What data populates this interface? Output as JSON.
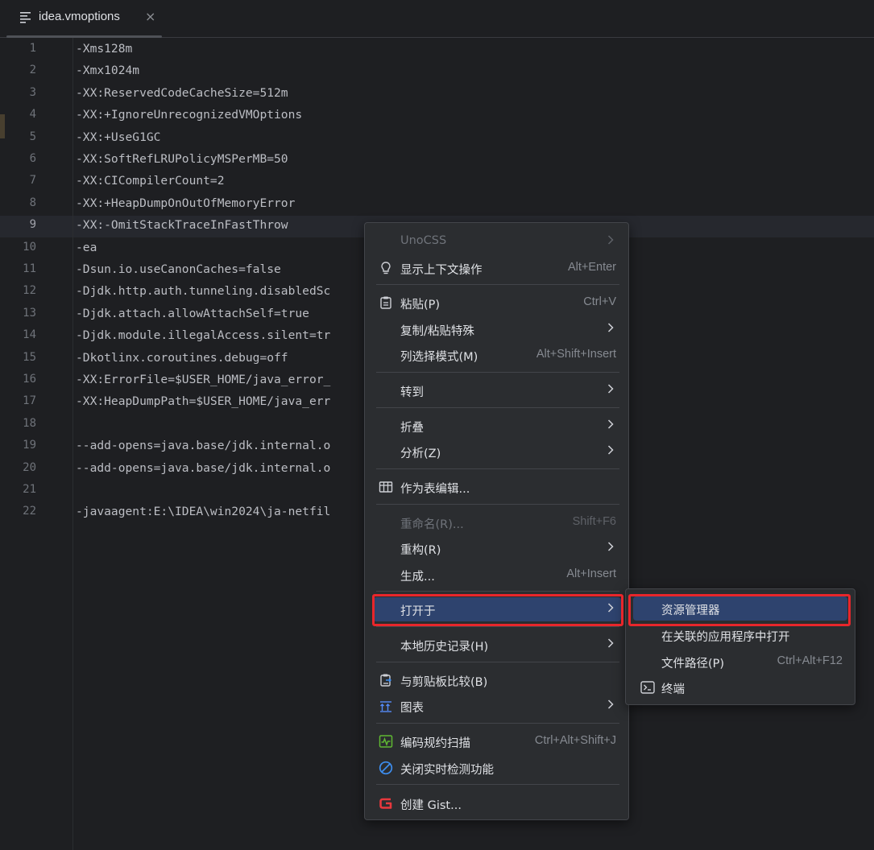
{
  "tab": {
    "name": "idea.vmoptions",
    "close": "×",
    "icon": "text-file-icon"
  },
  "editor": {
    "current_line": 9,
    "lines": [
      {
        "n": "1",
        "text": "-Xms128m"
      },
      {
        "n": "2",
        "text": "-Xmx1024m"
      },
      {
        "n": "3",
        "text": "-XX:ReservedCodeCacheSize=512m"
      },
      {
        "n": "4",
        "text": "-XX:+IgnoreUnrecognizedVMOptions"
      },
      {
        "n": "5",
        "text": "-XX:+UseG1GC"
      },
      {
        "n": "6",
        "text": "-XX:SoftRefLRUPolicyMSPerMB=50"
      },
      {
        "n": "7",
        "text": "-XX:CICompilerCount=2"
      },
      {
        "n": "8",
        "text": "-XX:+HeapDumpOnOutOfMemoryError"
      },
      {
        "n": "9",
        "text": "-XX:-OmitStackTraceInFastThrow"
      },
      {
        "n": "10",
        "text": "-ea"
      },
      {
        "n": "11",
        "text": "-Dsun.io.useCanonCaches=false"
      },
      {
        "n": "12",
        "text": "-Djdk.http.auth.tunneling.disabledSc"
      },
      {
        "n": "13",
        "text": "-Djdk.attach.allowAttachSelf=true"
      },
      {
        "n": "14",
        "text": "-Djdk.module.illegalAccess.silent=tr"
      },
      {
        "n": "15",
        "text": "-Dkotlinx.coroutines.debug=off"
      },
      {
        "n": "16",
        "text": "-XX:ErrorFile=$USER_HOME/java_error_"
      },
      {
        "n": "17",
        "text": "-XX:HeapDumpPath=$USER_HOME/java_err"
      },
      {
        "n": "18",
        "text": ""
      },
      {
        "n": "19",
        "text": "--add-opens=java.base/jdk.internal.o"
      },
      {
        "n": "20",
        "text": "--add-opens=java.base/jdk.internal.o"
      },
      {
        "n": "21",
        "text": ""
      },
      {
        "n": "22",
        "text": "-javaagent:E:\\IDEA\\win2024\\ja-netfil"
      }
    ]
  },
  "context_menu": {
    "unocss": {
      "label": "UnoCSS",
      "disabled": true
    },
    "show_context_actions": {
      "label": "显示上下文操作",
      "shortcut": "Alt+Enter",
      "icon": "lightbulb-icon"
    },
    "paste": {
      "label": "粘贴(P)",
      "shortcut": "Ctrl+V",
      "icon": "clipboard-icon"
    },
    "paste_special": {
      "label": "复制/粘贴特殊"
    },
    "column_selection": {
      "label": "列选择模式(M)",
      "shortcut": "Alt+Shift+Insert"
    },
    "goto": {
      "label": "转到"
    },
    "folding": {
      "label": "折叠"
    },
    "analyze": {
      "label": "分析(Z)"
    },
    "edit_as_table": {
      "label": "作为表编辑...",
      "icon": "table-icon"
    },
    "rename": {
      "label": "重命名(R)...",
      "shortcut": "Shift+F6",
      "disabled": true
    },
    "refactor": {
      "label": "重构(R)"
    },
    "generate": {
      "label": "生成...",
      "shortcut": "Alt+Insert"
    },
    "open_in": {
      "label": "打开于",
      "selected": true
    },
    "local_history": {
      "label": "本地历史记录(H)"
    },
    "compare_clipboard": {
      "label": "与剪贴板比较(B)",
      "icon": "compare-clipboard-icon"
    },
    "diagrams": {
      "label": "图表",
      "icon": "diagram-icon"
    },
    "code_scan": {
      "label": "编码规约扫描",
      "shortcut": "Ctrl+Alt+Shift+J",
      "icon": "code-scan-icon"
    },
    "close_realtime_check": {
      "label": "关闭实时检测功能",
      "icon": "disable-circle-icon"
    },
    "create_gist": {
      "label": "创建 Gist...",
      "icon": "gist-icon"
    }
  },
  "submenu": {
    "explorer": {
      "label": "资源管理器",
      "selected": true
    },
    "associated_app": {
      "label": "在关联的应用程序中打开"
    },
    "file_path": {
      "label": "文件路径(P)",
      "shortcut": "Ctrl+Alt+F12"
    },
    "terminal": {
      "label": "终端",
      "icon": "terminal-icon"
    }
  },
  "colors": {
    "background": "#1e1f22",
    "menu_background": "#2b2d30",
    "selection": "#2e436e",
    "highlight_border": "#e8262b"
  }
}
